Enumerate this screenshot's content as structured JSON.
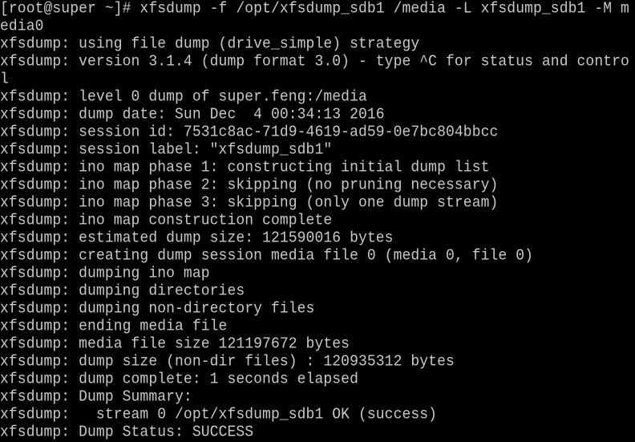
{
  "terminal": {
    "lines": [
      "[root@super ~]# xfsdump -f /opt/xfsdump_sdb1 /media -L xfsdump_sdb1 -M m",
      "edia0",
      "xfsdump: using file dump (drive_simple) strategy",
      "xfsdump: version 3.1.4 (dump format 3.0) - type ^C for status and contro",
      "l",
      "xfsdump: level 0 dump of super.feng:/media",
      "xfsdump: dump date: Sun Dec  4 00:34:13 2016",
      "xfsdump: session id: 7531c8ac-71d9-4619-ad59-0e7bc804bbcc",
      "xfsdump: session label: \"xfsdump_sdb1\"",
      "xfsdump: ino map phase 1: constructing initial dump list",
      "xfsdump: ino map phase 2: skipping (no pruning necessary)",
      "xfsdump: ino map phase 3: skipping (only one dump stream)",
      "xfsdump: ino map construction complete",
      "xfsdump: estimated dump size: 121590016 bytes",
      "xfsdump: creating dump session media file 0 (media 0, file 0)",
      "xfsdump: dumping ino map",
      "xfsdump: dumping directories",
      "xfsdump: dumping non-directory files",
      "xfsdump: ending media file",
      "xfsdump: media file size 121197672 bytes",
      "xfsdump: dump size (non-dir files) : 120935312 bytes",
      "xfsdump: dump complete: 1 seconds elapsed",
      "xfsdump: Dump Summary:",
      "xfsdump:   stream 0 /opt/xfsdump_sdb1 OK (success)",
      "xfsdump: Dump Status: SUCCESS"
    ],
    "colors": {
      "background": "#000000",
      "foreground": "#c8c8c8"
    }
  }
}
